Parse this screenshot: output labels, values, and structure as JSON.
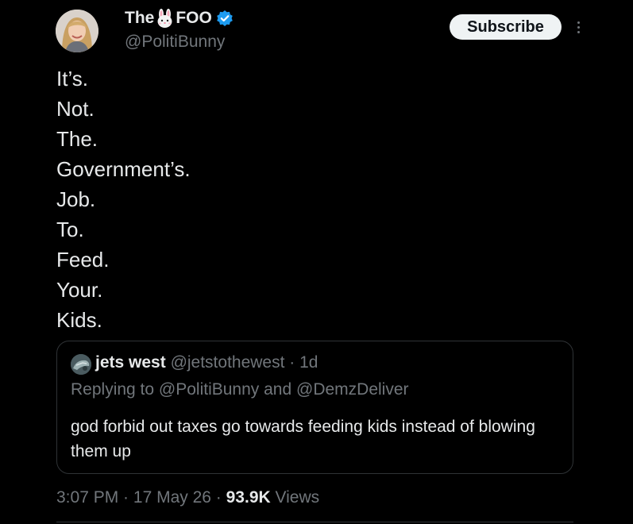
{
  "author": {
    "name_before": "The",
    "name_after": "FOO",
    "emoji_icon": "rabbit-face-icon",
    "verified_icon": "verified-badge-icon",
    "verified_color": "#1d9bf0",
    "handle": "@PolitiBunny"
  },
  "actions": {
    "subscribe_label": "Subscribe",
    "more_icon": "more-vertical-icon"
  },
  "tweet": {
    "lines": [
      "It’s.",
      "Not.",
      "The.",
      "Government’s.",
      "Job.",
      "To.",
      "Feed.",
      "Your.",
      "Kids."
    ]
  },
  "quote": {
    "name": "jets west",
    "handle": "@jetstothewest",
    "separator": " · ",
    "time": "1d",
    "reply_prefix": "Replying to ",
    "reply_user1": "@PolitiBunny",
    "reply_conj": " and ",
    "reply_user2": "@DemzDeliver",
    "text": "god forbid out taxes go towards feeding kids instead of blowing them up"
  },
  "footer": {
    "time": "3:07 PM",
    "sep1": " · ",
    "date": "17 May 26",
    "sep2": " · ",
    "views_count": "93.9K",
    "views_label": " Views"
  },
  "colors": {
    "background": "#000000",
    "text_primary": "#e7e9ea",
    "text_secondary": "#71767b",
    "border": "#2f3336",
    "button_bg": "#eff3f4"
  }
}
